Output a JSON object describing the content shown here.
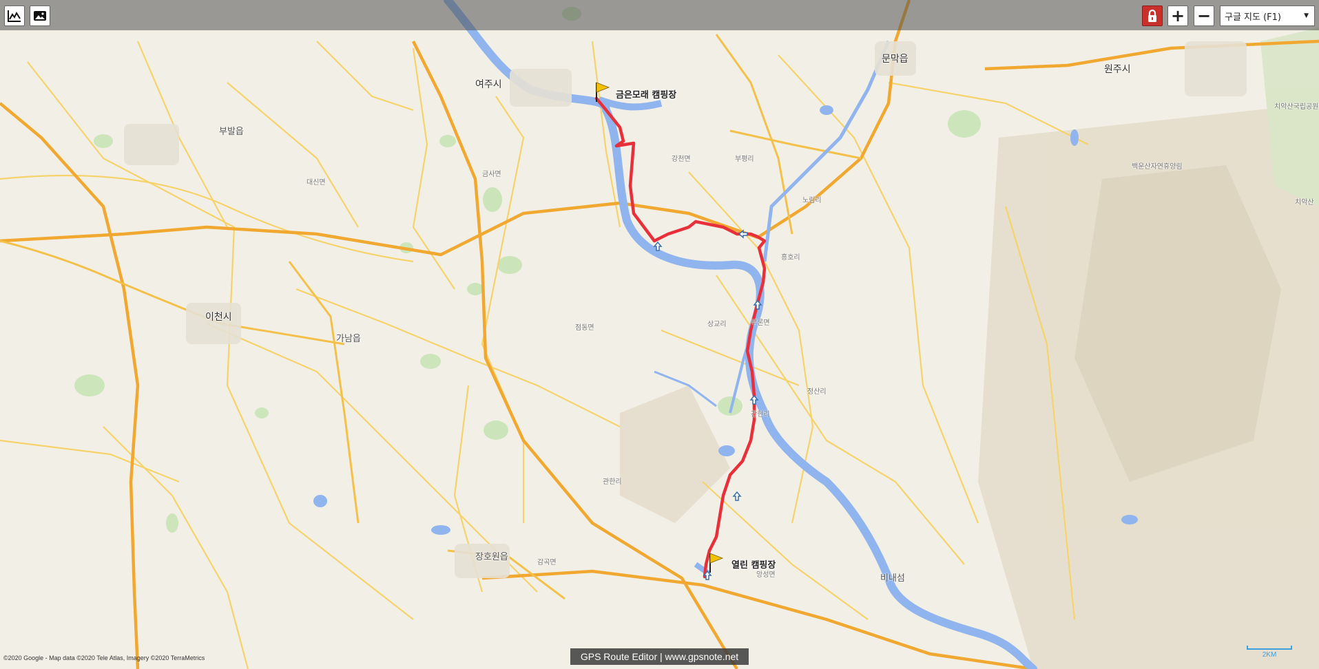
{
  "toolbar": {
    "chart_icon": "chart-line-icon",
    "image_icon": "image-icon",
    "lock_icon": "lock-icon",
    "zoom_in": "+",
    "zoom_out": "−",
    "map_type_selected": "구글 지도 (F1)"
  },
  "route": {
    "start_label": "금은모래 캠핑장",
    "end_label": "열린 캠핑장",
    "color": "#e8303a"
  },
  "places": {
    "yeoju": "여주시",
    "wonju": "원주시",
    "icheon": "이천시",
    "munmak": "문막읍",
    "bubal": "부발읍",
    "gaam": "가남읍",
    "janghowon": "장호원읍",
    "binaeseom": "비내섬",
    "baekunsan": "백운산자연휴양림",
    "chiak": "치악산국립공원",
    "chiak2": "치악산",
    "gangcheon": "강천면",
    "geumsa": "금사면",
    "jeomdong": "점동면",
    "bugeon": "부론면",
    "angseong": "앙성면",
    "gamgok": "감곡면",
    "daesin": "대신면",
    "ganhyeon": "간현리",
    "heungho": "흥호리",
    "jeongsan": "정산리",
    "nojeong": "노림리",
    "budong": "부평리",
    "sangyo": "상교리",
    "gwanhan": "관한리"
  },
  "map_attribution": "©2020 Google - Map data ©2020 Tele Atlas, Imagery ©2020 TerraMetrics",
  "footer": "GPS Route Editor | www.gpsnote.net",
  "scale_label": "2KM",
  "colors": {
    "water": "#8fb4ee",
    "highway": "#f0a830",
    "road": "#f6d36a",
    "land": "#f2efe6",
    "green": "#c8e3b5",
    "route": "#e8303a"
  }
}
